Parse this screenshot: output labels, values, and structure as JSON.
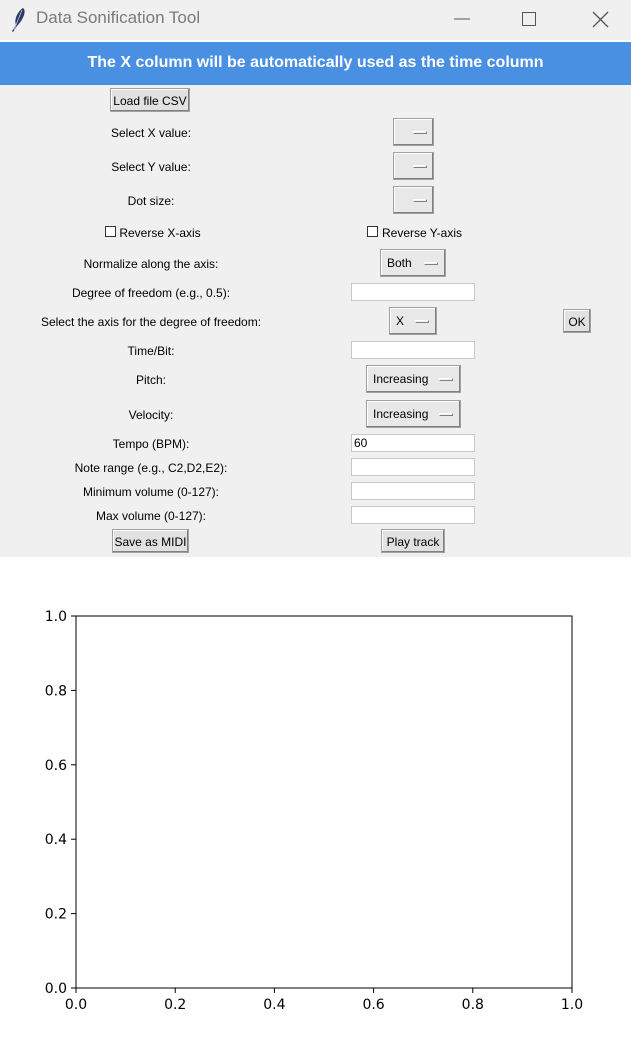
{
  "window": {
    "title": "Data Sonification Tool"
  },
  "banner": {
    "text": "The X column will be automatically used as the time column"
  },
  "form": {
    "load_button": "Load file CSV",
    "select_x_label": "Select X value:",
    "select_y_label": "Select Y value:",
    "dot_size_label": "Dot size:",
    "reverse_x_label": "Reverse X-axis",
    "reverse_y_label": "Reverse Y-axis",
    "normalize_label": "Normalize along the axis:",
    "normalize_value": "Both",
    "dof_label": "Degree of freedom  (e.g., 0.5):",
    "dof_value": "",
    "dof_axis_label": "Select the axis for the degree of freedom:",
    "dof_axis_value": "X",
    "ok_button": "OK",
    "time_bit_label": "Time/Bit:",
    "time_bit_value": "",
    "pitch_label": "Pitch:",
    "pitch_value": "Increasing",
    "velocity_label": "Velocity:",
    "velocity_value": "Increasing",
    "tempo_label": "Tempo (BPM):",
    "tempo_value": "60",
    "note_range_label": "Note range (e.g., C2,D2,E2):",
    "note_range_value": "",
    "min_volume_label": "Minimum volume (0-127):",
    "min_volume_value": "",
    "max_volume_label": "Max volume (0-127):",
    "max_volume_value": "",
    "save_midi_button": "Save as MIDI",
    "play_track_button": "Play track"
  },
  "chart_data": {
    "type": "scatter",
    "series": [],
    "xlim": [
      0.0,
      1.0
    ],
    "ylim": [
      0.0,
      1.0
    ],
    "xticks": [
      "0.0",
      "0.2",
      "0.4",
      "0.6",
      "0.8",
      "1.0"
    ],
    "yticks": [
      "0.0",
      "0.2",
      "0.4",
      "0.6",
      "0.8",
      "1.0"
    ],
    "title": "",
    "xlabel": "",
    "ylabel": "",
    "grid": false
  }
}
